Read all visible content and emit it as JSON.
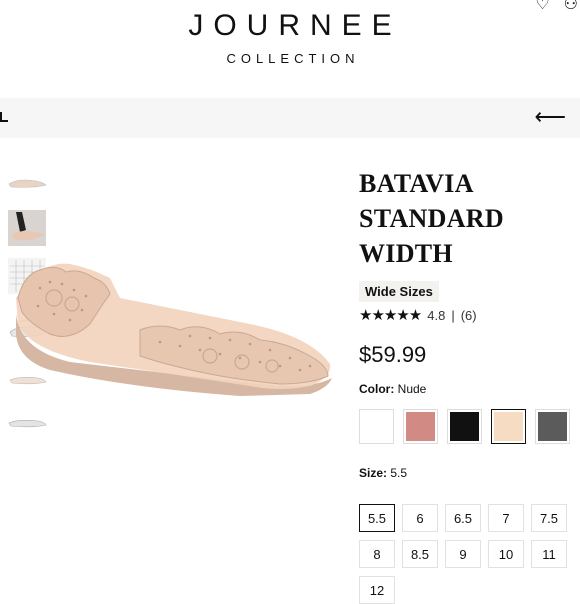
{
  "header": {
    "brand_title": "JOURNEE",
    "brand_sub": "COLLECTION"
  },
  "topbar": {
    "back_icon": "arrow-left-icon"
  },
  "product": {
    "title_lines": [
      "BATAVIA",
      "STANDARD",
      "WIDTH"
    ],
    "badge": "Wide Sizes",
    "rating_value": "4.8",
    "rating_sep": "|",
    "review_count": "(6)",
    "price": "$59.99",
    "color_label": "Color:",
    "color_value": "Nude",
    "swatches": [
      {
        "name": "White",
        "color": "#ffffff"
      },
      {
        "name": "Rose",
        "color": "#d28a85"
      },
      {
        "name": "Black",
        "color": "#111111"
      },
      {
        "name": "Nude",
        "color": "#f7dcc4",
        "selected": true
      },
      {
        "name": "Grey",
        "color": "#5b5b5b"
      }
    ],
    "size_label": "Size:",
    "size_value": "5.5",
    "sizes": [
      "5.5",
      "6",
      "6.5",
      "7",
      "7.5",
      "8",
      "8.5",
      "9",
      "10",
      "11",
      "12"
    ]
  },
  "colors": {
    "topbar_bg": "#f6f6f6",
    "mesh_nude": "#f0cdb4",
    "crystal": "#d8b9a5"
  }
}
